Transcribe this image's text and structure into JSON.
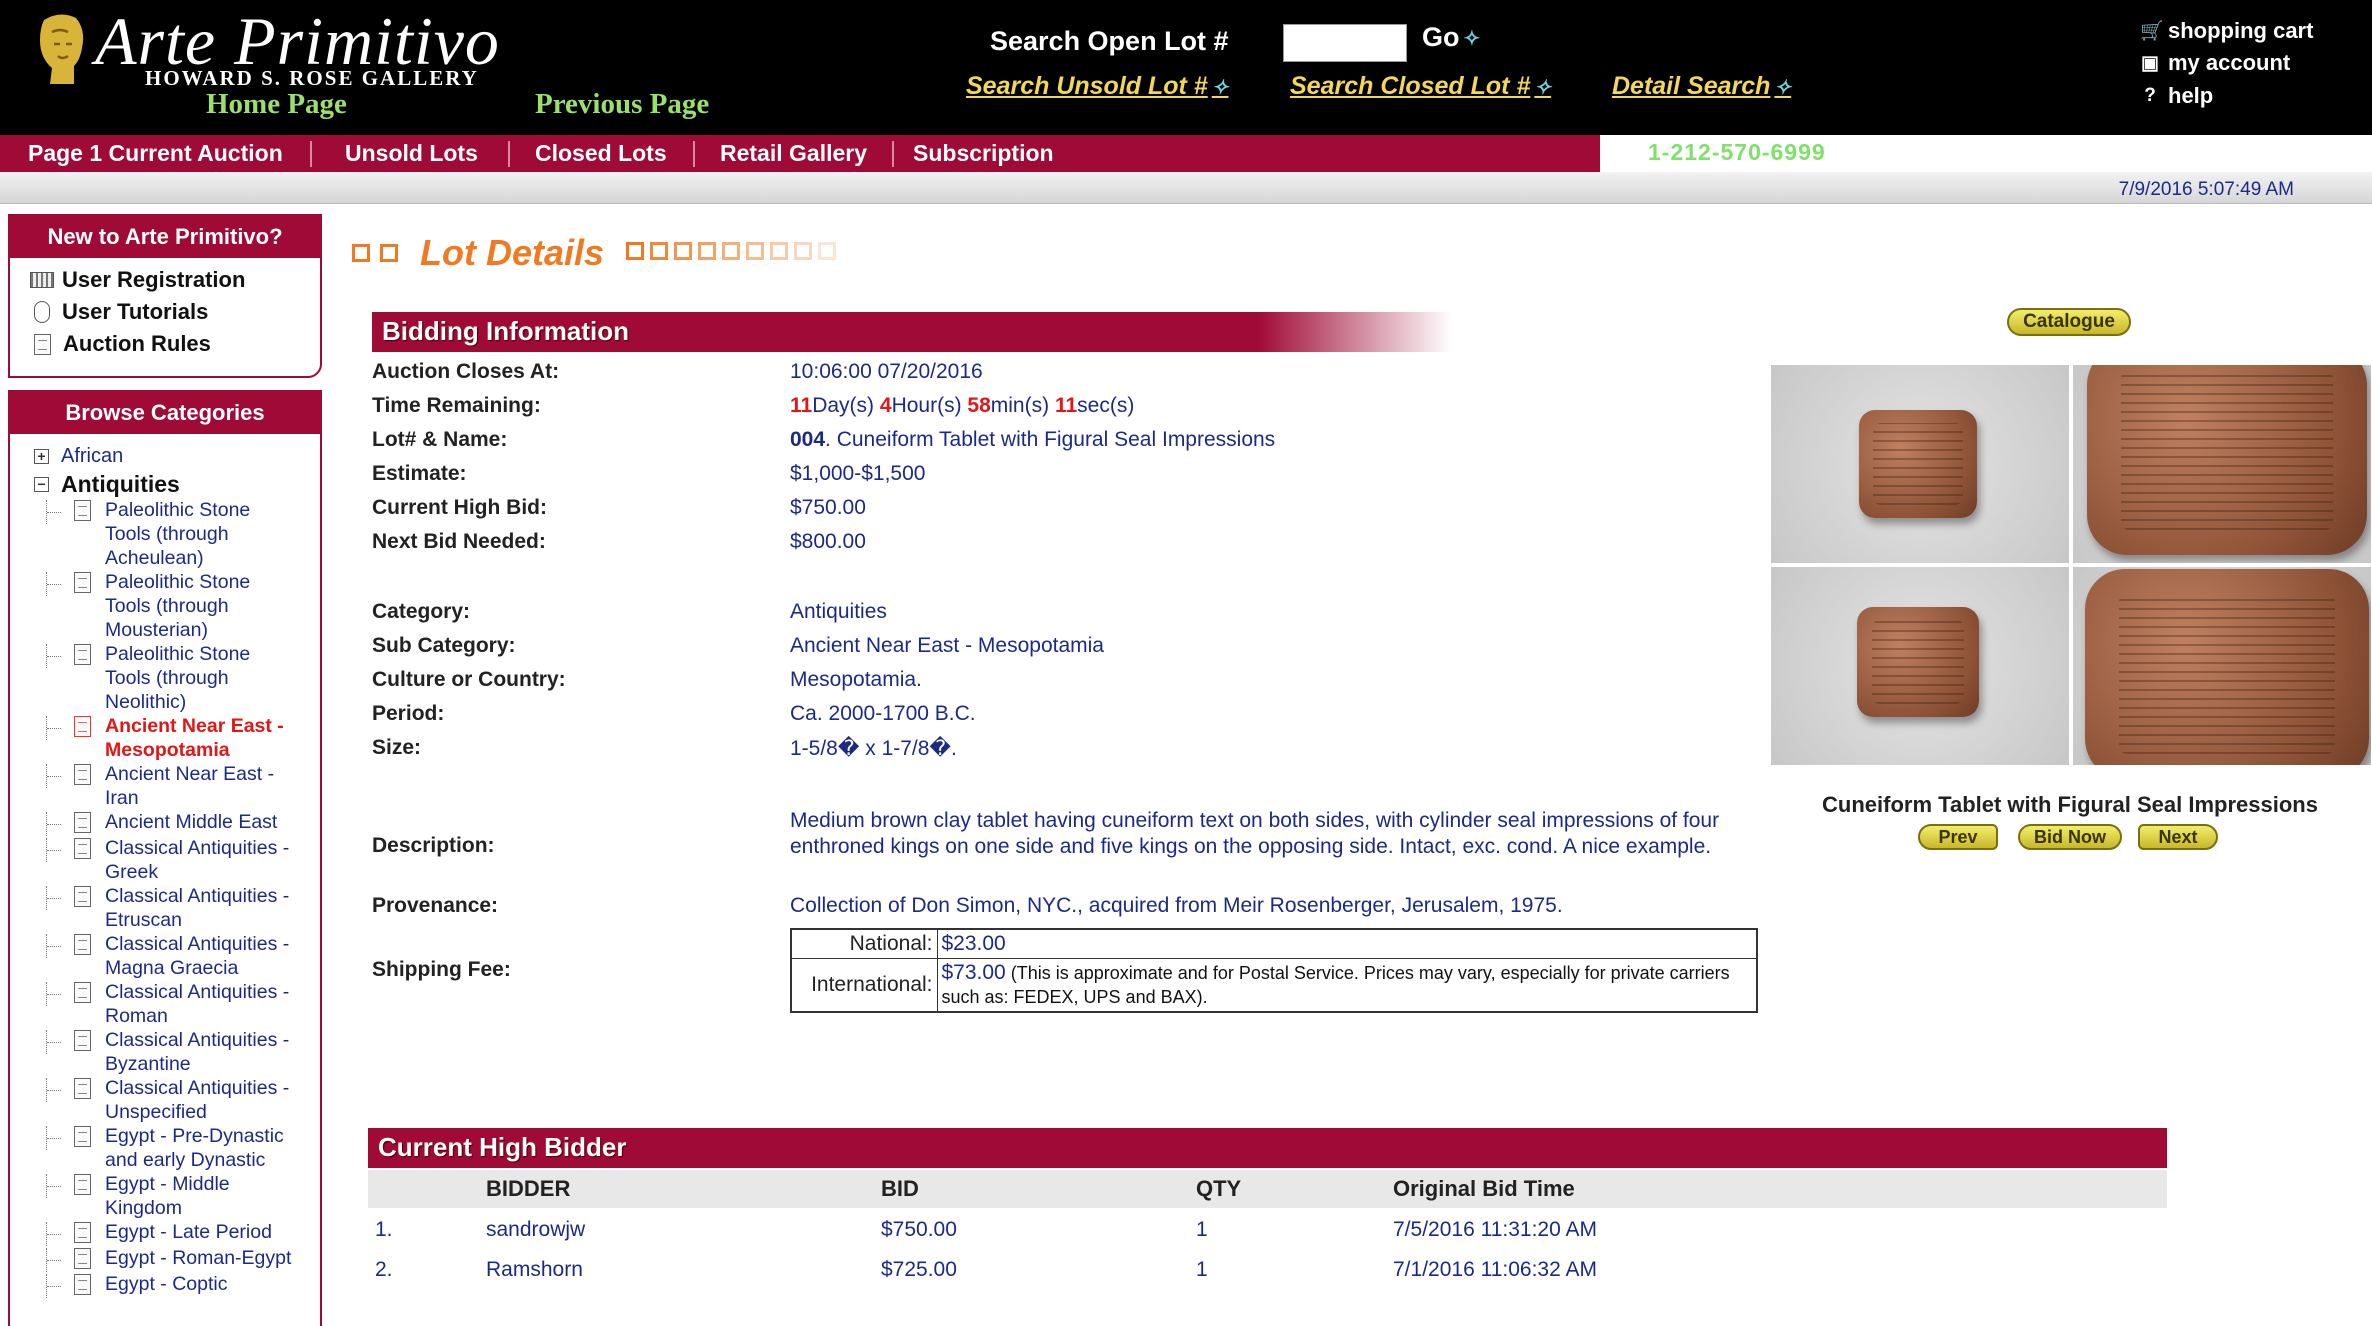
{
  "header": {
    "logo_title": "Arte Primitivo",
    "logo_subtitle": "HOWARD S. ROSE GALLERY",
    "home_link": "Home Page",
    "previous_link": "Previous Page",
    "search_label": "Search Open Lot #",
    "search_value": "",
    "go_label": "Go",
    "search_unsold": "Search Unsold Lot #",
    "search_closed": "Search Closed Lot #",
    "detail_search": "Detail Search",
    "shopping_cart": "shopping cart",
    "my_account": "my account",
    "help": "help"
  },
  "nav": {
    "items": [
      "Page 1 Current Auction",
      "Unsold Lots",
      "Closed Lots",
      "Retail Gallery",
      "Subscription"
    ],
    "phone": "1-212-570-6999"
  },
  "datetime": "7/9/2016 5:07:49 AM",
  "sidebar": {
    "new_title": "New to Arte Primitivo?",
    "new_items": [
      "User Registration",
      "User Tutorials",
      "Auction Rules"
    ],
    "browse_title": "Browse Categories",
    "top_categories": [
      {
        "label": "African",
        "toggle": "+"
      },
      {
        "label": "Antiquities",
        "toggle": "−"
      }
    ],
    "subcategories": [
      "Paleolithic Stone Tools (through Acheulean)",
      "Paleolithic Stone Tools (through Mousterian)",
      "Paleolithic Stone Tools (through Neolithic)",
      "Ancient Near East - Mesopotamia",
      "Ancient Near East - Iran",
      "Ancient Middle East",
      "Classical Antiquities - Greek",
      "Classical Antiquities - Etruscan",
      "Classical Antiquities - Magna Graecia",
      "Classical Antiquities - Roman",
      "Classical Antiquities - Byzantine",
      "Classical Antiquities - Unspecified",
      "Egypt - Pre-Dynastic and early Dynastic",
      "Egypt - Middle Kingdom",
      "Egypt - Late Period",
      "Egypt - Roman-Egypt",
      "Egypt - Coptic"
    ],
    "active_index": 3
  },
  "main": {
    "title": "Lot Details",
    "bidding_title": "Bidding Information",
    "labels": {
      "closes": "Auction Closes At:",
      "remaining": "Time Remaining:",
      "lot": "Lot# & Name:",
      "estimate": "Estimate:",
      "high_bid": "Current High Bid:",
      "next_bid": "Next Bid Needed:",
      "category": "Category:",
      "sub_category": "Sub Category:",
      "culture": "Culture or Country:",
      "period": "Period:",
      "size": "Size:",
      "description": "Description:",
      "provenance": "Provenance:",
      "shipping": "Shipping Fee:"
    },
    "values": {
      "closes": "10:06:00 07/20/2016",
      "days": "11",
      "days_unit": "Day(s) ",
      "hours": "4",
      "hours_unit": "Hour(s) ",
      "mins": "58",
      "mins_unit": "min(s) ",
      "secs": "11",
      "secs_unit": "sec(s)",
      "lot_number": "004",
      "lot_name": ". Cuneiform Tablet with Figural Seal Impressions",
      "estimate": "$1,000-$1,500",
      "high_bid": "$750.00",
      "next_bid": "$800.00",
      "category": "Antiquities",
      "sub_category": "Ancient Near East - Mesopotamia",
      "culture": "Mesopotamia.",
      "period": "Ca. 2000-1700 B.C.",
      "size": "1-5/8� x 1-7/8�.",
      "description": "Medium brown clay tablet having cuneiform text on both sides, with cylinder seal impressions of four enthroned kings on one side and five kings on the opposing side. Intact, exc. cond. A nice example.",
      "provenance": "Collection of Don Simon, NYC., acquired from Meir Rosenberger, Jerusalem, 1975."
    },
    "shipping": {
      "national_label": "National:",
      "national_amount": "$23.00",
      "international_label": "International:",
      "international_amount": "$73.00",
      "international_note": " (This is approximate and for Postal Service. Prices may vary, especially for private carriers such as: FEDEX, UPS and BAX)."
    }
  },
  "right_panel": {
    "catalogue": "Catalogue",
    "caption": "Cuneiform Tablet with Figural Seal Impressions",
    "prev": "Prev",
    "bid_now": "Bid Now",
    "next": "Next"
  },
  "bidders": {
    "title": "Current High Bidder",
    "columns": [
      "BIDDER",
      "BID",
      "QTY",
      "Original Bid Time"
    ],
    "rows": [
      {
        "rank": "1.",
        "bidder": "sandrowjw",
        "bid": "$750.00",
        "qty": "1",
        "time": "7/5/2016 11:31:20 AM"
      },
      {
        "rank": "2.",
        "bidder": "Ramshorn",
        "bid": "$725.00",
        "qty": "1",
        "time": "7/1/2016 11:06:32 AM"
      }
    ]
  }
}
